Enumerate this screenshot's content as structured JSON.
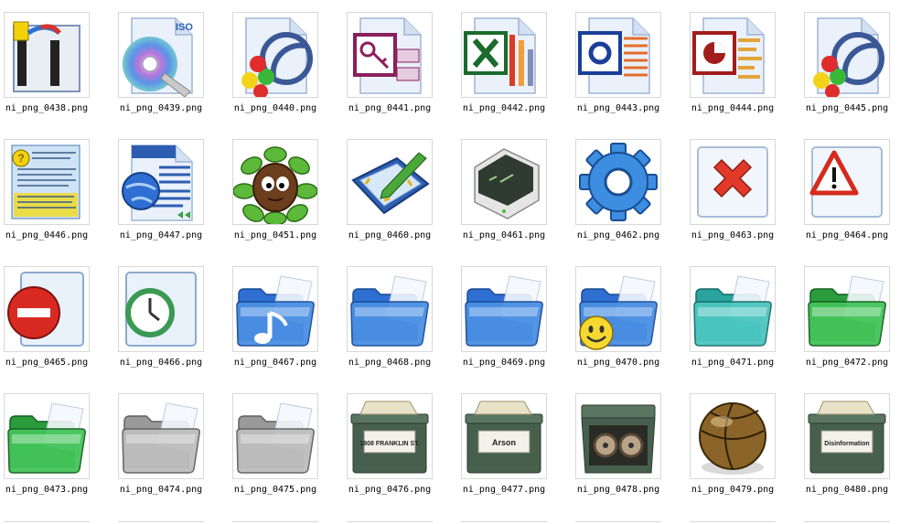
{
  "window": {
    "title": ""
  },
  "files": [
    {
      "name": "ni_png_0438.png",
      "icon": "binder-tool-icon"
    },
    {
      "name": "ni_png_0439.png",
      "icon": "iso-disc-icon",
      "text": "ISO"
    },
    {
      "name": "ni_png_0440.png",
      "icon": "rss-colored-balls-icon"
    },
    {
      "name": "ni_png_0441.png",
      "icon": "access-key-icon"
    },
    {
      "name": "ni_png_0442.png",
      "icon": "excel-icon"
    },
    {
      "name": "ni_png_0443.png",
      "icon": "publisher-icon"
    },
    {
      "name": "ni_png_0444.png",
      "icon": "powerpoint-icon"
    },
    {
      "name": "ni_png_0445.png",
      "icon": "rss-colored-balls-icon"
    },
    {
      "name": "ni_png_0446.png",
      "icon": "help-document-icon"
    },
    {
      "name": "ni_png_0447.png",
      "icon": "web-document-icon"
    },
    {
      "name": "ni_png_0451.png",
      "icon": "creature-in-leaves-icon"
    },
    {
      "name": "ni_png_0460.png",
      "icon": "tablet-pen-icon"
    },
    {
      "name": "ni_png_0461.png",
      "icon": "terminal-icon"
    },
    {
      "name": "ni_png_0462.png",
      "icon": "gear-icon"
    },
    {
      "name": "ni_png_0463.png",
      "icon": "error-x-icon"
    },
    {
      "name": "ni_png_0464.png",
      "icon": "warning-triangle-icon"
    },
    {
      "name": "ni_png_0465.png",
      "icon": "stop-sign-icon"
    },
    {
      "name": "ni_png_0466.png",
      "icon": "clock-document-icon"
    },
    {
      "name": "ni_png_0467.png",
      "icon": "music-folder-icon"
    },
    {
      "name": "ni_png_0468.png",
      "icon": "blue-folder-icon"
    },
    {
      "name": "ni_png_0469.png",
      "icon": "blue-folder-icon"
    },
    {
      "name": "ni_png_0470.png",
      "icon": "smiley-folder-icon"
    },
    {
      "name": "ni_png_0471.png",
      "icon": "teal-folder-icon"
    },
    {
      "name": "ni_png_0472.png",
      "icon": "green-folder-icon"
    },
    {
      "name": "ni_png_0473.png",
      "icon": "green-folder-icon"
    },
    {
      "name": "ni_png_0474.png",
      "icon": "gray-folder-icon"
    },
    {
      "name": "ni_png_0475.png",
      "icon": "gray-folder-icon"
    },
    {
      "name": "ni_png_0476.png",
      "icon": "storage-box-icon",
      "text": "1808 FRANKLIN ST."
    },
    {
      "name": "ni_png_0477.png",
      "icon": "storage-box-icon",
      "text": "Arson"
    },
    {
      "name": "ni_png_0478.png",
      "icon": "open-box-reels-icon"
    },
    {
      "name": "ni_png_0479.png",
      "icon": "leather-ball-icon"
    },
    {
      "name": "ni_png_0480.png",
      "icon": "storage-box-icon",
      "text": "Disinformation"
    }
  ]
}
